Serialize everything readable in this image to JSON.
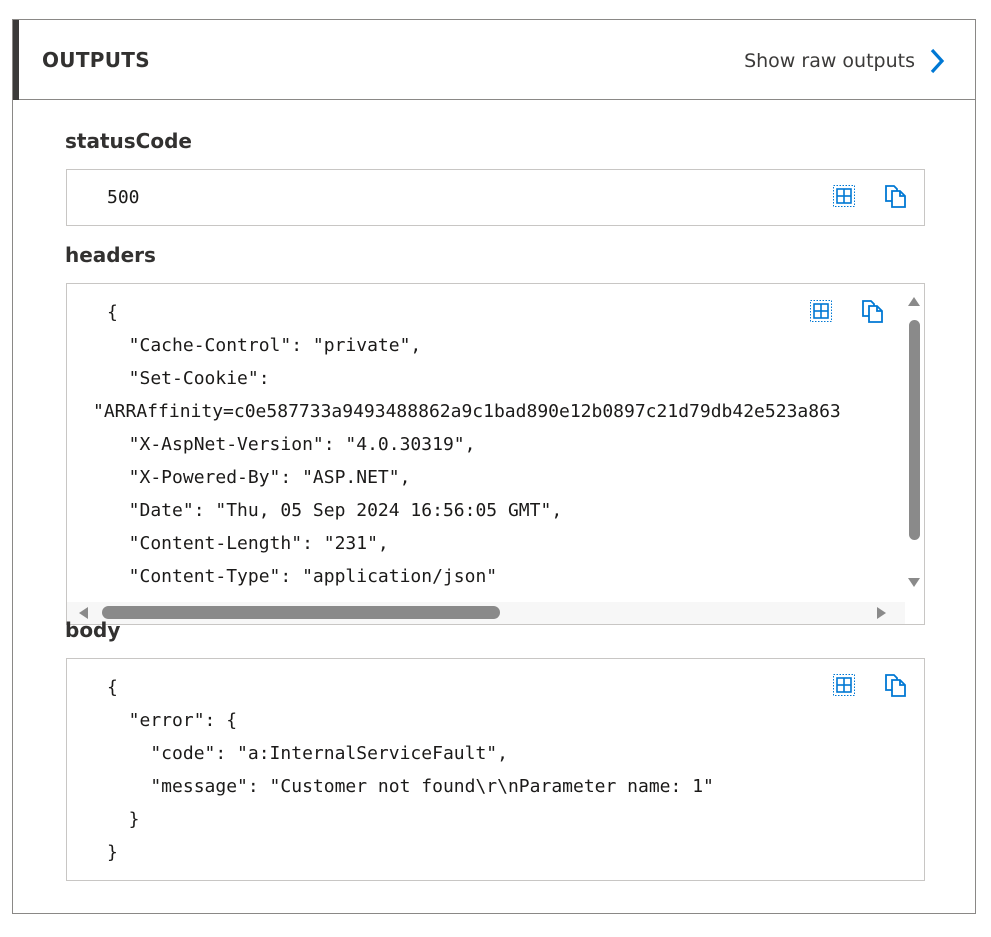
{
  "header": {
    "title": "OUTPUTS",
    "raw_link_label": "Show raw outputs",
    "raw_link_icon": "chevron-right-icon",
    "accent_color": "#0078d4"
  },
  "status_code": {
    "label": "statusCode",
    "value": "500"
  },
  "headers": {
    "label": "headers",
    "lines": [
      "{",
      "  \"Cache-Control\": \"private\",",
      "  \"Set-Cookie\":",
      "\"ARRAffinity=c0e587733a9493488862a9c1bad890e12b0897c21d79db42e523a863",
      "  \"X-AspNet-Version\": \"4.0.30319\",",
      "  \"X-Powered-By\": \"ASP.NET\",",
      "  \"Date\": \"Thu, 05 Sep 2024 16:56:05 GMT\",",
      "  \"Content-Length\": \"231\",",
      "  \"Content-Type\": \"application/json\""
    ]
  },
  "body": {
    "label": "body",
    "lines": [
      "{",
      "  \"error\": {",
      "    \"code\": \"a:InternalServiceFault\",",
      "    \"message\": \"Customer not found\\r\\nParameter name: 1\"",
      "  }",
      "}"
    ]
  },
  "icons": {
    "grid": "grid-view-icon",
    "copy": "copy-icon"
  }
}
